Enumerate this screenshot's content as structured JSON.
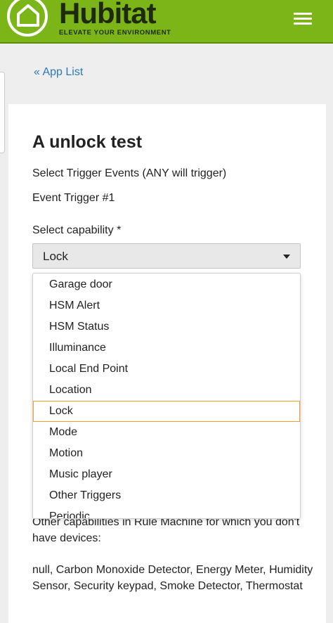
{
  "header": {
    "brand_name": "Hubitat",
    "tagline": "ELEVATE YOUR ENVIRONMENT",
    "bg_color": "#7cb518",
    "menu_icon": "hamburger-icon"
  },
  "nav": {
    "back_link": "« App List"
  },
  "page": {
    "title": "A unlock test",
    "subtitle": "Select Trigger Events (ANY will trigger)",
    "event_trigger": "Event Trigger #1",
    "capability_label": "Select capability *"
  },
  "capability_select": {
    "selected_value": "Lock",
    "options": [
      "Garage door",
      "HSM Alert",
      "HSM Status",
      "Illuminance",
      "Local End Point",
      "Location",
      "Lock",
      "Mode",
      "Motion",
      "Music player",
      "Other Triggers",
      "Periodic"
    ],
    "highlighted_index": 6,
    "highlight_color": "#f0a030"
  },
  "footer": {
    "other_capabilities": "Other capabilities in Rule Machine for which you don't have devices:",
    "missing_list": "null, Carbon Monoxide Detector, Energy Meter, Humidity Sensor, Security keypad, Smoke Detector, Thermostat"
  }
}
